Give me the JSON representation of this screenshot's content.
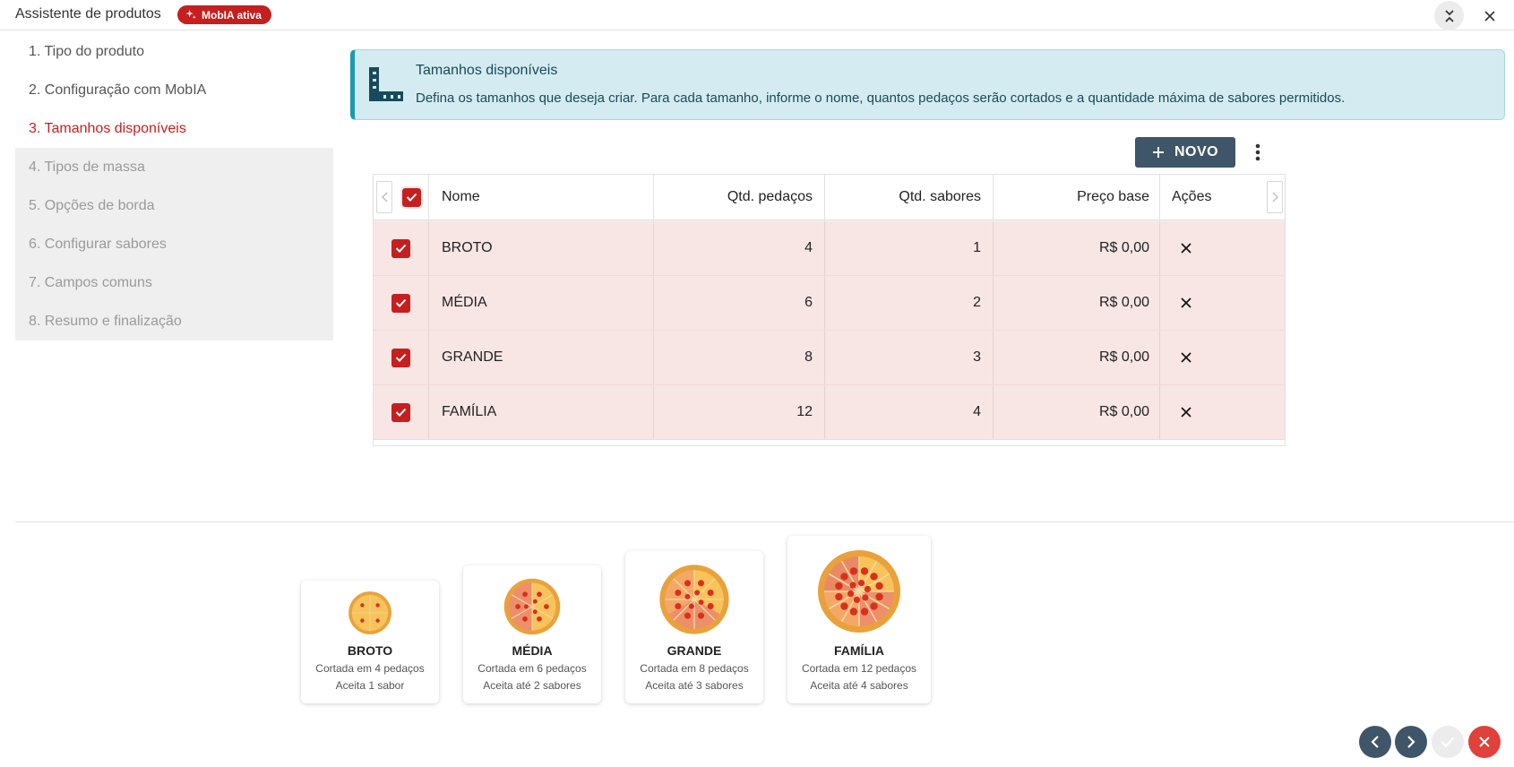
{
  "window": {
    "title": "Assistente de produtos",
    "ai_badge": "MobIA ativa",
    "collapse_icon": "collapse-icon",
    "close_icon": "close-icon"
  },
  "steps": [
    {
      "label": "1. Tipo do produto",
      "state": "done"
    },
    {
      "label": "2. Configuração com MobIA",
      "state": "done"
    },
    {
      "label": "3. Tamanhos disponíveis",
      "state": "active"
    },
    {
      "label": "4. Tipos de massa",
      "state": "disabled"
    },
    {
      "label": "5. Opções de borda",
      "state": "disabled"
    },
    {
      "label": "6. Configurar sabores",
      "state": "disabled"
    },
    {
      "label": "7. Campos comuns",
      "state": "disabled"
    },
    {
      "label": "8. Resumo e finalização",
      "state": "disabled"
    }
  ],
  "banner": {
    "title": "Tamanhos disponíveis",
    "text": "Defina os tamanhos que deseja criar. Para cada tamanho, informe o nome, quantos pedaços serão cortados e a quantidade máxima de sabores permitidos.",
    "icon": "ruler-icon"
  },
  "toolbar": {
    "new_label": "NOVO",
    "more_icon": "more-vertical-icon"
  },
  "table": {
    "columns": [
      "Nome",
      "Qtd. pedaços",
      "Qtd. sabores",
      "Preço base",
      "Ações"
    ],
    "rows": [
      {
        "nome": "BROTO",
        "pedacos": "4",
        "sabores": "1",
        "preco": "R$ 0,00",
        "checked": true
      },
      {
        "nome": "MÉDIA",
        "pedacos": "6",
        "sabores": "2",
        "preco": "R$ 0,00",
        "checked": true
      },
      {
        "nome": "GRANDE",
        "pedacos": "8",
        "sabores": "3",
        "preco": "R$ 0,00",
        "checked": true
      },
      {
        "nome": "FAMÍLIA",
        "pedacos": "12",
        "sabores": "4",
        "preco": "R$ 0,00",
        "checked": true
      }
    ]
  },
  "preview": [
    {
      "name": "BROTO",
      "slices_text": "Cortada em 4 pedaços",
      "flavors_text": "Aceita 1 sabor",
      "slices": 4,
      "flavors": 1
    },
    {
      "name": "MÉDIA",
      "slices_text": "Cortada em 6 pedaços",
      "flavors_text": "Aceita até 2 sabores",
      "slices": 6,
      "flavors": 2
    },
    {
      "name": "GRANDE",
      "slices_text": "Cortada em 8 pedaços",
      "flavors_text": "Aceita até 3 sabores",
      "slices": 8,
      "flavors": 3
    },
    {
      "name": "FAMÍLIA",
      "slices_text": "Cortada em 12 pedaços",
      "flavors_text": "Aceita até 4 sabores",
      "slices": 12,
      "flavors": 4
    }
  ],
  "footer": {
    "prev_icon": "chevron-left-icon",
    "next_icon": "chevron-right-icon",
    "finish_icon": "check-icon",
    "cancel_icon": "close-icon"
  },
  "colors": {
    "accent": "#c61f1f",
    "primary_button": "#3f5568",
    "row_highlight": "#f8e6e5",
    "banner_bg": "#d4ecf1"
  }
}
